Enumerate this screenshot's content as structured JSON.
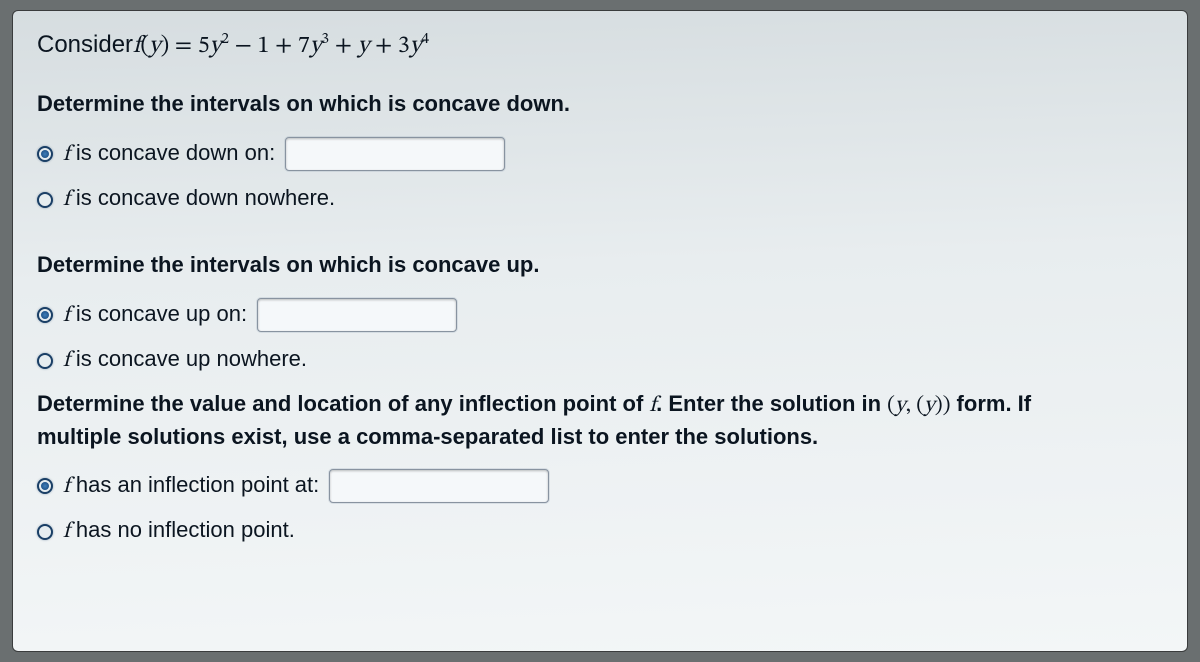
{
  "question": {
    "prefix": "Consider ",
    "func_lhs": "f(y) = ",
    "poly_terms": "5y² − 1 + 7y³ + y + 3y⁴"
  },
  "concave_down": {
    "heading": "Determine the intervals on which  is concave down.",
    "opt_on_label": " is concave down on:",
    "opt_nowhere_label": " is concave down nowhere.",
    "input_value": "",
    "selected": "on"
  },
  "concave_up": {
    "heading": "Determine the intervals on which  is concave up.",
    "opt_on_label": " is concave up on:",
    "opt_nowhere_label": " is concave up nowhere.",
    "input_value": "",
    "selected": "on"
  },
  "inflection": {
    "heading_l1_a": "Determine the value and location of any inflection point of ",
    "heading_l1_f": "f",
    "heading_l1_b": ". Enter the solution in ",
    "heading_pair": "(y, (y))",
    "heading_l1_c": " form. If",
    "heading_l2": "multiple solutions exist, use a comma-separated list to enter the solutions.",
    "opt_has_label": " has an inflection point at:",
    "opt_none_label": " has no inflection point.",
    "input_value": "",
    "selected": "has"
  },
  "math": {
    "f_italic": "f"
  }
}
